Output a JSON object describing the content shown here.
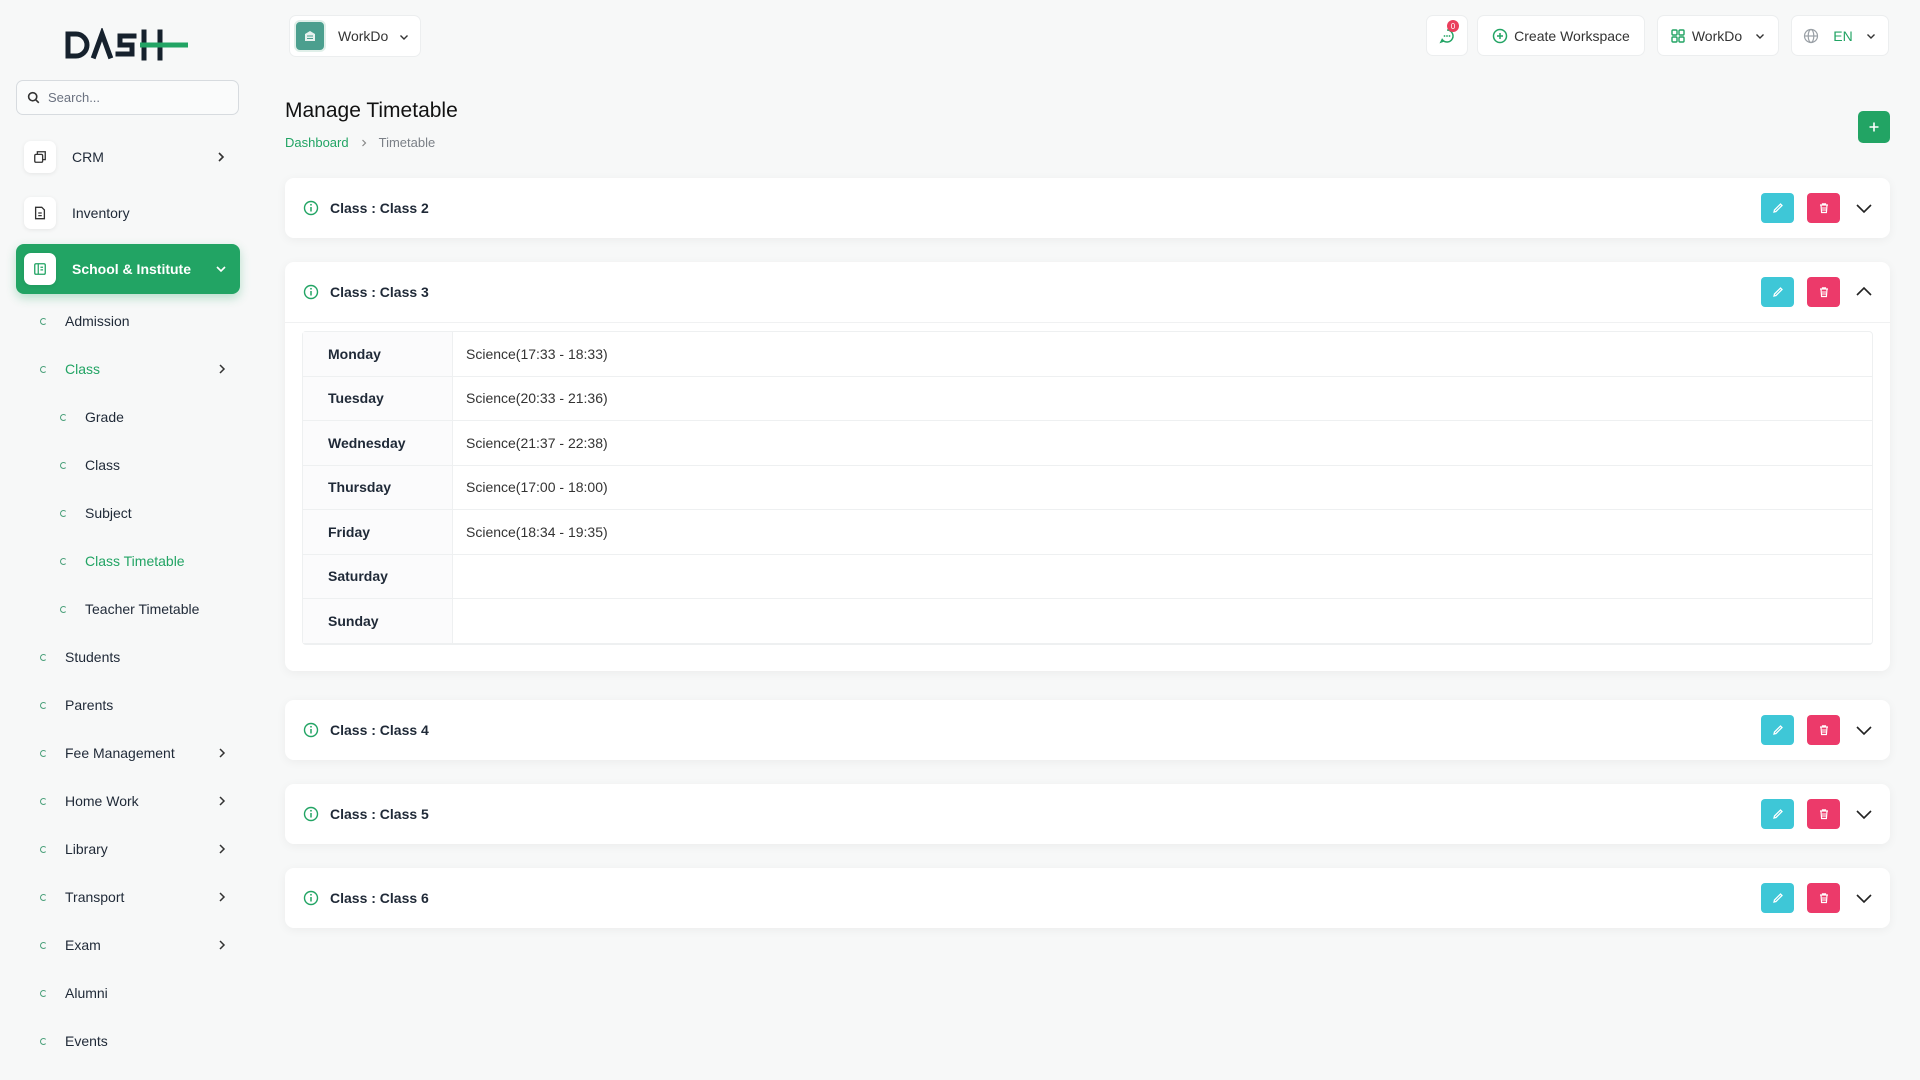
{
  "search": {
    "placeholder": "Search..."
  },
  "sidebar": {
    "main": [
      {
        "label": "CRM"
      },
      {
        "label": "Inventory"
      },
      {
        "label": "School & Institute"
      }
    ],
    "sub": [
      {
        "label": "Admission"
      },
      {
        "label": "Class"
      },
      {
        "label": "Grade"
      },
      {
        "label": "Class"
      },
      {
        "label": "Subject"
      },
      {
        "label": "Class Timetable"
      },
      {
        "label": "Teacher Timetable"
      },
      {
        "label": "Students"
      },
      {
        "label": "Parents"
      },
      {
        "label": "Fee Management"
      },
      {
        "label": "Home Work"
      },
      {
        "label": "Library"
      },
      {
        "label": "Transport"
      },
      {
        "label": "Exam"
      },
      {
        "label": "Alumni"
      },
      {
        "label": "Events"
      }
    ]
  },
  "topbar": {
    "workspace": "WorkDo",
    "notification_count": "0",
    "create_workspace": "Create Workspace",
    "workspace_menu": "WorkDo",
    "language": "EN"
  },
  "page": {
    "title": "Manage Timetable",
    "breadcrumb": {
      "home": "Dashboard",
      "current": "Timetable"
    }
  },
  "classes": [
    {
      "title": "Class : Class 2"
    },
    {
      "title": "Class : Class 3"
    },
    {
      "title": "Class : Class 4"
    },
    {
      "title": "Class : Class 5"
    },
    {
      "title": "Class : Class 6"
    }
  ],
  "timetable": [
    {
      "day": "Monday",
      "value": "Science(17:33 - 18:33)"
    },
    {
      "day": "Tuesday",
      "value": "Science(20:33 - 21:36)"
    },
    {
      "day": "Wednesday",
      "value": "Science(21:37 - 22:38)"
    },
    {
      "day": "Thursday",
      "value": "Science(17:00 - 18:00)"
    },
    {
      "day": "Friday",
      "value": "Science(18:34 - 19:35)"
    },
    {
      "day": "Saturday",
      "value": ""
    },
    {
      "day": "Sunday",
      "value": ""
    }
  ],
  "colors": {
    "accent": "#22a464",
    "edit": "#3ec7d7",
    "delete": "#ec3a6a"
  }
}
